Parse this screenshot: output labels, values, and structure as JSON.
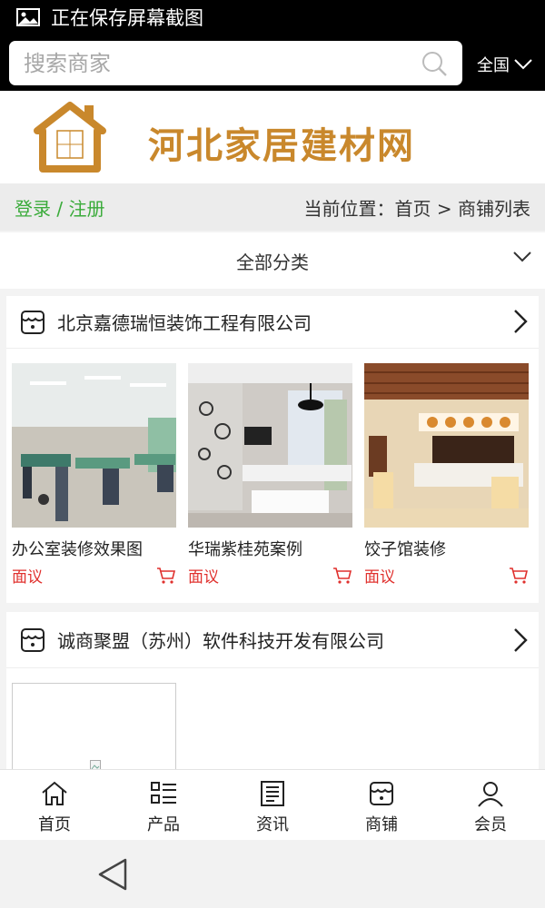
{
  "status": {
    "text": "正在保存屏幕截图"
  },
  "search": {
    "placeholder": "搜索商家",
    "region": "全国"
  },
  "banner": {
    "logo_text": "家居建材",
    "site_name": "河北家居建材网"
  },
  "locbar": {
    "login": "登录 / 注册",
    "breadcrumb": "当前位置：首页 > 商铺列表"
  },
  "category": {
    "label": "全部分类"
  },
  "shops": [
    {
      "name": "北京嘉德瑞恒装饰工程有限公司",
      "products": [
        {
          "name": "办公室装修效果图",
          "price": "面议"
        },
        {
          "name": "华瑞紫桂苑案例",
          "price": "面议"
        },
        {
          "name": "饺子馆装修",
          "price": "面议"
        }
      ]
    },
    {
      "name": "诚商聚盟（苏州）软件科技开发有限公司"
    }
  ],
  "tabbar": [
    {
      "label": "首页",
      "icon": "home-icon"
    },
    {
      "label": "产品",
      "icon": "list-icon"
    },
    {
      "label": "资讯",
      "icon": "news-icon"
    },
    {
      "label": "商铺",
      "icon": "store-icon"
    },
    {
      "label": "会员",
      "icon": "user-icon"
    }
  ],
  "colors": {
    "accent_green": "#3aab3a",
    "price_red": "#e0312e",
    "brand_gold": "#c9882c"
  }
}
